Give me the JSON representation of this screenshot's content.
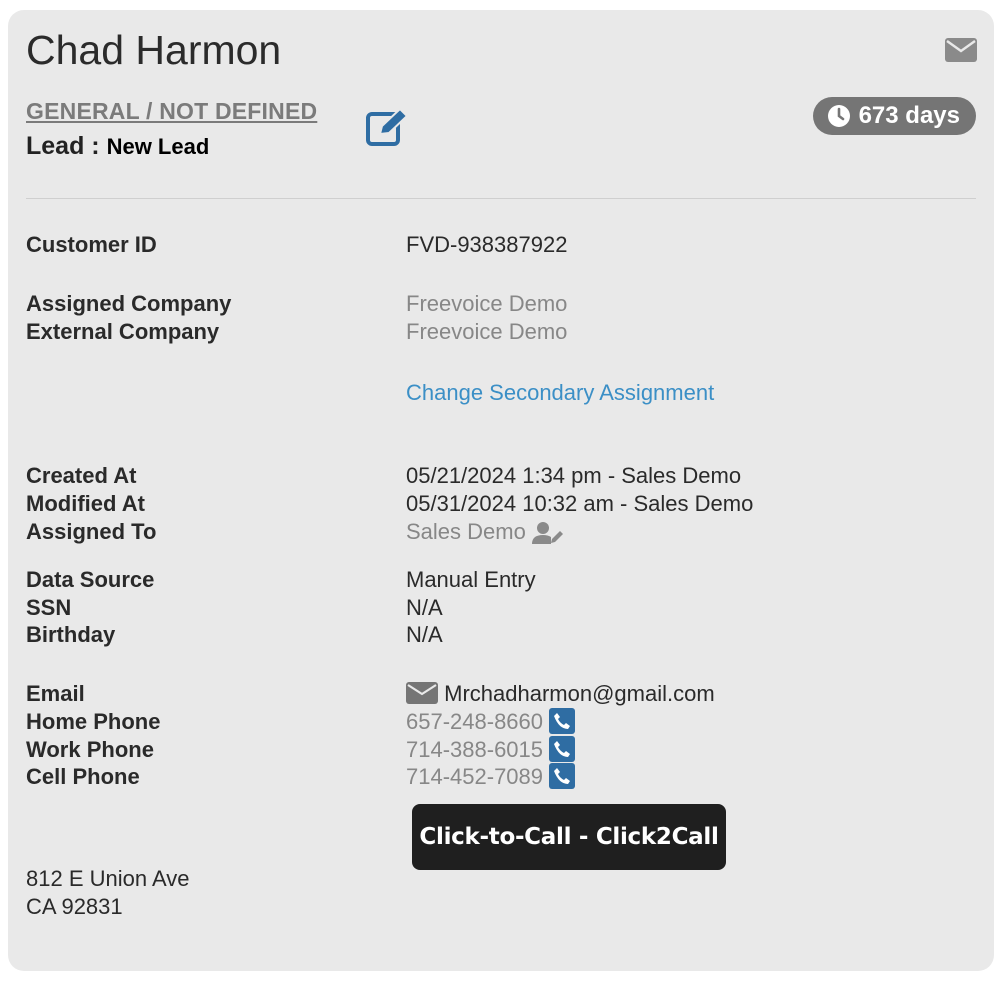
{
  "contact": {
    "name": "Chad Harmon",
    "category": "GENERAL / NOT DEFINED",
    "status_label": "Lead : ",
    "status_value": "New Lead",
    "days": "673 days"
  },
  "fields": {
    "customer_id": {
      "label": "Customer ID",
      "value": "FVD-938387922"
    },
    "assigned_company": {
      "label": "Assigned Company",
      "value": "Freevoice Demo"
    },
    "external_company": {
      "label": "External Company",
      "value": "Freevoice Demo"
    },
    "change_secondary": "Change Secondary Assignment",
    "created_at": {
      "label": "Created At",
      "value": "05/21/2024 1:34 pm - Sales Demo"
    },
    "modified_at": {
      "label": "Modified At",
      "value": "05/31/2024 10:32 am - Sales Demo"
    },
    "assigned_to": {
      "label": "Assigned To",
      "value": "Sales Demo"
    },
    "data_source": {
      "label": "Data Source",
      "value": "Manual Entry"
    },
    "ssn": {
      "label": "SSN",
      "value": "N/A"
    },
    "birthday": {
      "label": "Birthday",
      "value": "N/A"
    },
    "email": {
      "label": "Email",
      "value": "Mrchadharmon@gmail.com"
    },
    "home_phone": {
      "label": "Home Phone",
      "value": "657-248-8660"
    },
    "work_phone": {
      "label": "Work Phone",
      "value": "714-388-6015"
    },
    "cell_phone": {
      "label": "Cell Phone",
      "value": "714-452-7089"
    }
  },
  "tooltip": "Click-to-Call - Click2Call",
  "address": {
    "line1": "812 E Union Ave",
    "line2": "CA 92831"
  },
  "icons": [
    "envelope-icon",
    "edit-icon",
    "clock-icon",
    "user-edit-icon",
    "phone-icon"
  ],
  "colors": {
    "badge": "#757575",
    "link": "#3b8fc6",
    "phone_button": "#2f6da3",
    "edit_icon": "#2f6da3"
  }
}
